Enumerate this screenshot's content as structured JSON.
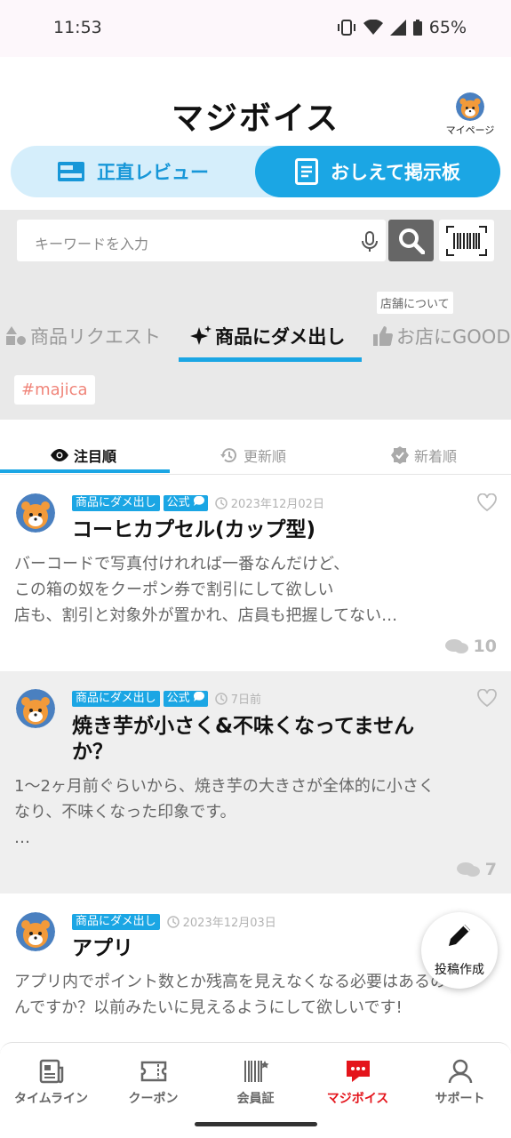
{
  "status": {
    "time": "11:53",
    "battery": "65%"
  },
  "header": {
    "logo": "マジボイス",
    "mypage_label": "マイページ"
  },
  "segment": {
    "left_label": "正直レビュー",
    "right_label": "おしえて掲示板"
  },
  "search": {
    "placeholder": "キーワードを入力"
  },
  "category_tabs": {
    "tooltip": "店舗について",
    "items": [
      {
        "label": "商品リクエスト",
        "icon": "shapes-icon"
      },
      {
        "label": "商品にダメ出し",
        "icon": "sparkle-icon"
      },
      {
        "label": "お店にGOOD",
        "icon": "thumbs-up-icon"
      }
    ],
    "active_index": 1
  },
  "hashtag": "#majica",
  "sort_tabs": [
    {
      "label": "注目順",
      "icon": "eye-icon"
    },
    {
      "label": "更新順",
      "icon": "history-icon"
    },
    {
      "label": "新着順",
      "icon": "verified-icon"
    }
  ],
  "posts": [
    {
      "category": "商品にダメ出し",
      "official": "公式",
      "date": "2023年12月02日",
      "title": "コーヒカプセル(カップ型)",
      "body_lines": [
        "バーコードで写真付けれれば一番なんだけど、",
        "この箱の奴をクーポン券で割引にして欲しい",
        "店も、割引と対象外が置かれ、店員も把握してない…"
      ],
      "comments": "10"
    },
    {
      "category": "商品にダメ出し",
      "official": "公式",
      "date": "7日前",
      "title_lines": [
        "焼き芋が小さく&不味くなってません",
        "か？"
      ],
      "body_lines": [
        "1〜2ヶ月前ぐらいから、焼き芋の大きさが全体的に小さく",
        "なり、不味くなった印象です。",
        "…"
      ],
      "comments": "7"
    },
    {
      "category": "商品にダメ出し",
      "date": "2023年12月03日",
      "title": "アプリ",
      "body_lines": [
        "アプリ内でポイント数とか残高を見えなくなる必要はあるの",
        "んですか？以前みたいに見えるようにして欲しいです!"
      ]
    }
  ],
  "fab": {
    "label": "投稿作成"
  },
  "bottom_nav": [
    {
      "label": "タイムライン",
      "icon": "newspaper-icon"
    },
    {
      "label": "クーポン",
      "icon": "ticket-icon"
    },
    {
      "label": "会員証",
      "icon": "barcode-icon"
    },
    {
      "label": "マジボイス",
      "icon": "chat-icon"
    },
    {
      "label": "サポート",
      "icon": "person-icon"
    }
  ],
  "colors": {
    "accent": "#1ba6e4",
    "active_nav": "#e4141b",
    "hashtag": "#f0857a"
  }
}
